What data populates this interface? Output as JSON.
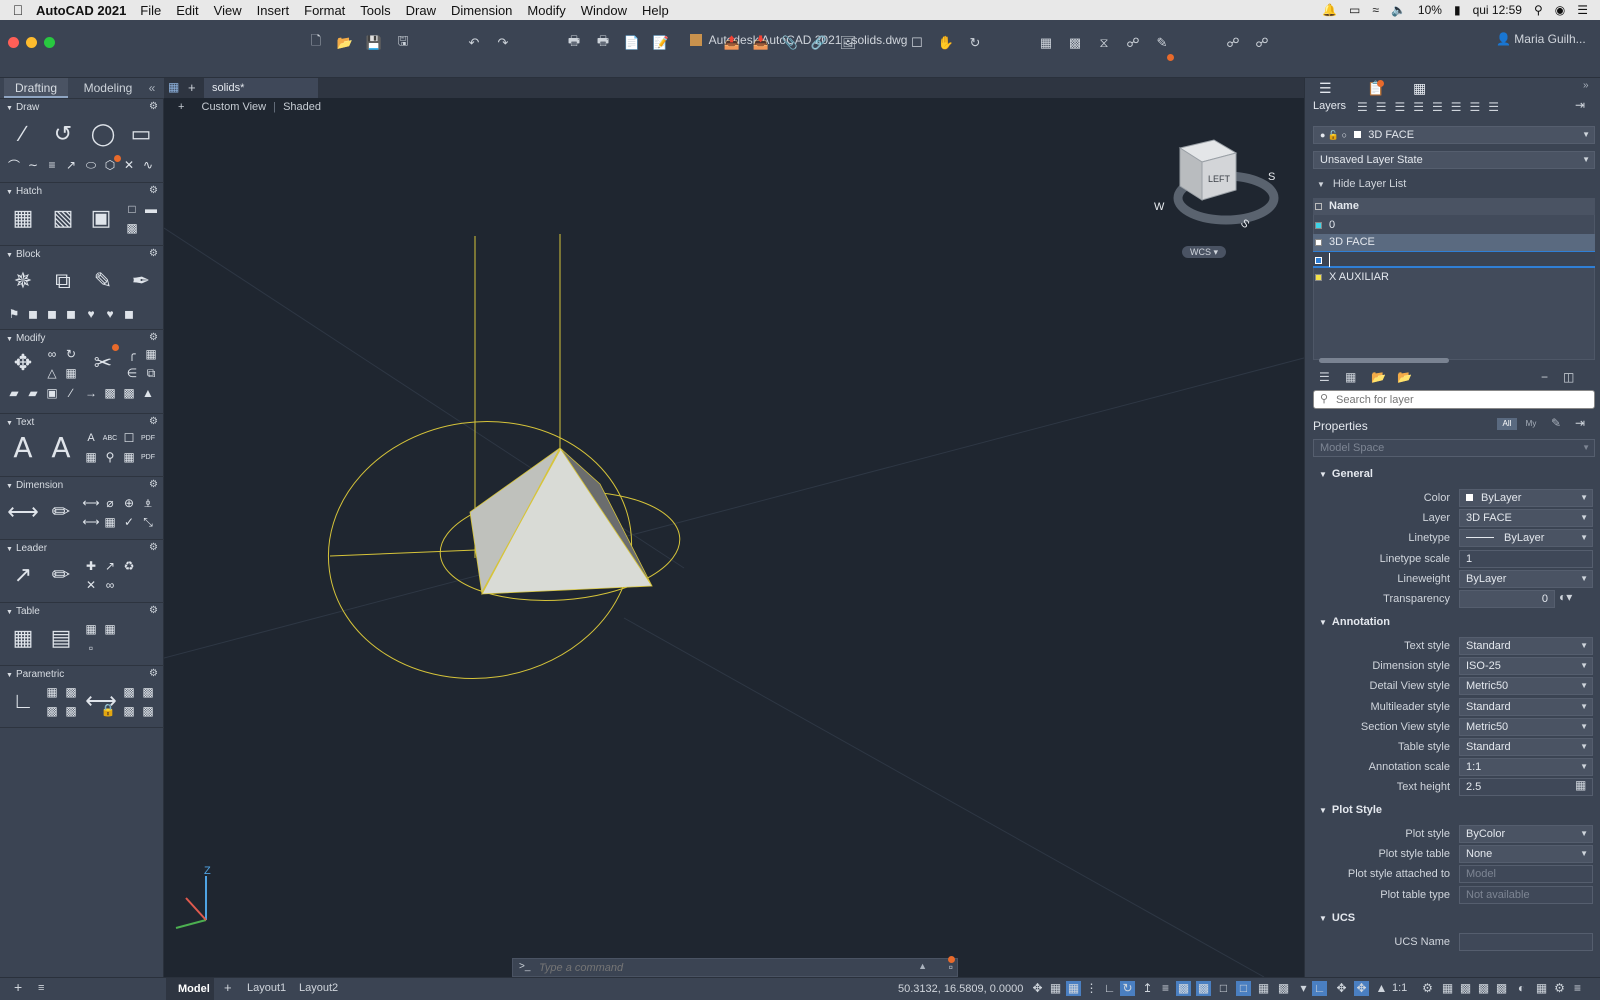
{
  "menubar": {
    "app_name": "AutoCAD 2021",
    "items": [
      "File",
      "Edit",
      "View",
      "Insert",
      "Format",
      "Tools",
      "Draw",
      "Dimension",
      "Modify",
      "Window",
      "Help"
    ],
    "battery": "10%",
    "clock": "qui 12:59"
  },
  "window": {
    "title": "Autodesk AutoCAD 2021",
    "file": "solids.dwg",
    "user": "Maria Guilh..."
  },
  "left_tabs": {
    "drafting": "Drafting",
    "modeling": "Modeling"
  },
  "palette": {
    "draw": "Draw",
    "hatch": "Hatch",
    "block": "Block",
    "modify": "Modify",
    "text": "Text",
    "dimension": "Dimension",
    "leader": "Leader",
    "table": "Table",
    "parametric": "Parametric"
  },
  "doc_tab": "solids*",
  "viewport": {
    "plus": "+",
    "view": "Custom View",
    "style": "Shaded",
    "wcs": "WCS",
    "cube_face": "LEFT",
    "compass": {
      "n": "N",
      "s": "S",
      "w": "W"
    },
    "ucs_z": "Z"
  },
  "command": {
    "prompt": ">_",
    "placeholder": "Type a command"
  },
  "status": {
    "model": "Model",
    "layout1": "Layout1",
    "layout2": "Layout2",
    "coords": "50.3132, 16.5809, 0.0000",
    "scale": "1:1"
  },
  "layers": {
    "title": "Layers",
    "current": "3D FACE",
    "state": "Unsaved Layer State",
    "hide_list": "Hide Layer List",
    "col_name": "Name",
    "rows": [
      {
        "name": "0",
        "color": "#3fd3e6"
      },
      {
        "name": "3D FACE",
        "color": "#ffffff"
      },
      {
        "name": "",
        "color": "#2f7fd6"
      },
      {
        "name": "X AUXILIAR",
        "color": "#f2e14a"
      }
    ],
    "search_placeholder": "Search for layer"
  },
  "properties": {
    "title": "Properties",
    "btn_all": "All",
    "btn_my": "My",
    "space": "Model Space",
    "general": {
      "header": "General",
      "rows": [
        {
          "label": "Color",
          "value": "ByLayer"
        },
        {
          "label": "Layer",
          "value": "3D FACE"
        },
        {
          "label": "Linetype",
          "value": "ByLayer"
        },
        {
          "label": "Linetype scale",
          "value": "1"
        },
        {
          "label": "Lineweight",
          "value": "ByLayer"
        },
        {
          "label": "Transparency",
          "value": "0"
        }
      ]
    },
    "annotation": {
      "header": "Annotation",
      "rows": [
        {
          "label": "Text style",
          "value": "Standard"
        },
        {
          "label": "Dimension style",
          "value": "ISO-25"
        },
        {
          "label": "Detail View style",
          "value": "Metric50"
        },
        {
          "label": "Multileader style",
          "value": "Standard"
        },
        {
          "label": "Section View style",
          "value": "Metric50"
        },
        {
          "label": "Table style",
          "value": "Standard"
        },
        {
          "label": "Annotation scale",
          "value": "1:1"
        },
        {
          "label": "Text height",
          "value": "2.5"
        }
      ]
    },
    "plot": {
      "header": "Plot Style",
      "rows": [
        {
          "label": "Plot style",
          "value": "ByColor"
        },
        {
          "label": "Plot style table",
          "value": "None"
        },
        {
          "label": "Plot style attached to",
          "value": "Model"
        },
        {
          "label": "Plot table type",
          "value": "Not available"
        }
      ]
    },
    "ucs": {
      "header": "UCS",
      "rows": [
        {
          "label": "UCS Name",
          "value": ""
        }
      ]
    }
  },
  "colors": {
    "accent": "#e86a2b",
    "drawing": "#d6c43a",
    "face": "#d9dbd6"
  }
}
